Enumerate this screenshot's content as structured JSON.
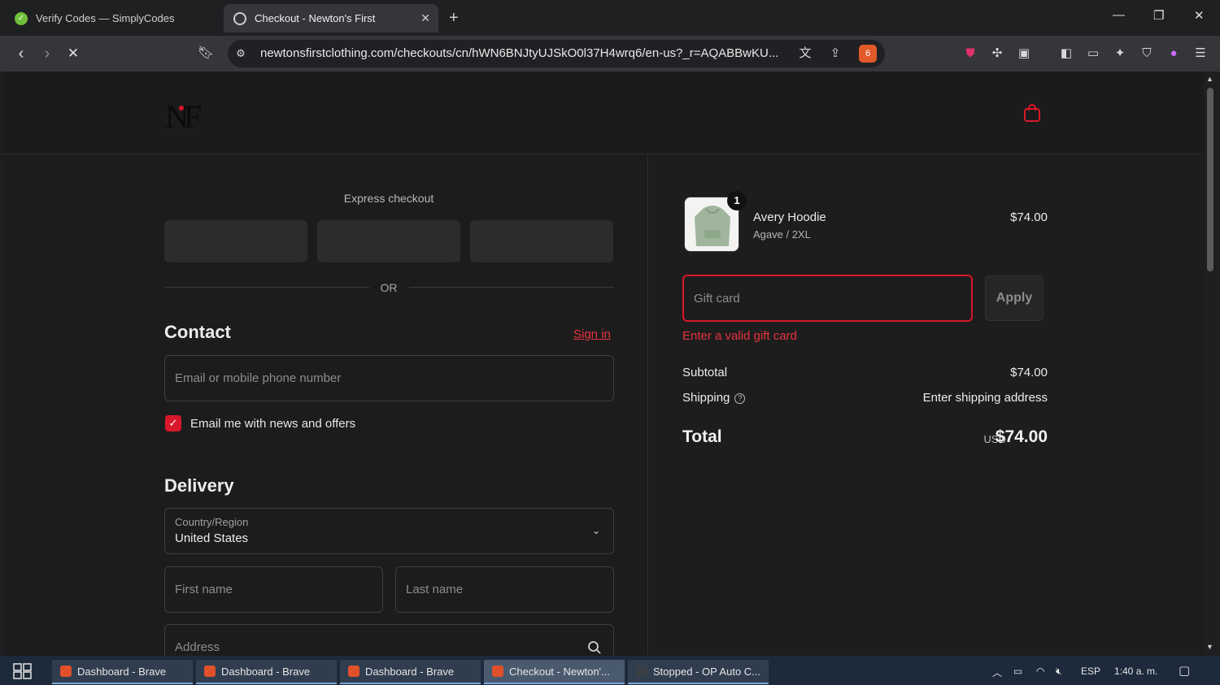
{
  "browser": {
    "tabs": [
      {
        "title": "Verify Codes — SimplyCodes",
        "active": false
      },
      {
        "title": "Checkout - Newton's First",
        "active": true
      }
    ],
    "url": "newtonsfirstclothing.com/checkouts/cn/hWN6BNJtyUJSkO0l37H4wrq6/en-us?_r=AQABBwKU...",
    "brave_badge": "6"
  },
  "store": {
    "logo_text": "NF"
  },
  "checkout": {
    "express_title": "Express checkout",
    "or_text": "OR",
    "contact_heading": "Contact",
    "signin_label": "Sign in",
    "email_placeholder": "Email or mobile phone number",
    "newsletter_label": "Email me with news and offers",
    "newsletter_checked": true,
    "delivery_heading": "Delivery",
    "country_label": "Country/Region",
    "country_value": "United States",
    "first_name_placeholder": "First name",
    "last_name_placeholder": "Last name",
    "address_placeholder": "Address"
  },
  "summary": {
    "item_qty": "1",
    "item_name": "Avery Hoodie",
    "item_variant": "Agave / 2XL",
    "item_price": "$74.00",
    "gift_placeholder": "Gift card",
    "apply_label": "Apply",
    "gift_error": "Enter a valid gift card",
    "subtotal_label": "Subtotal",
    "subtotal_value": "$74.00",
    "shipping_label": "Shipping",
    "shipping_value": "Enter shipping address",
    "total_label": "Total",
    "currency": "USD",
    "total_value": "$74.00",
    "accent_color": "#d8182a"
  },
  "taskbar": {
    "items": [
      {
        "label": "Dashboard - Brave"
      },
      {
        "label": "Dashboard - Brave"
      },
      {
        "label": "Dashboard - Brave"
      },
      {
        "label": "Checkout - Newton'..."
      },
      {
        "label": "Stopped - OP Auto C..."
      }
    ],
    "language": "ESP",
    "time": "1:40 a. m."
  }
}
